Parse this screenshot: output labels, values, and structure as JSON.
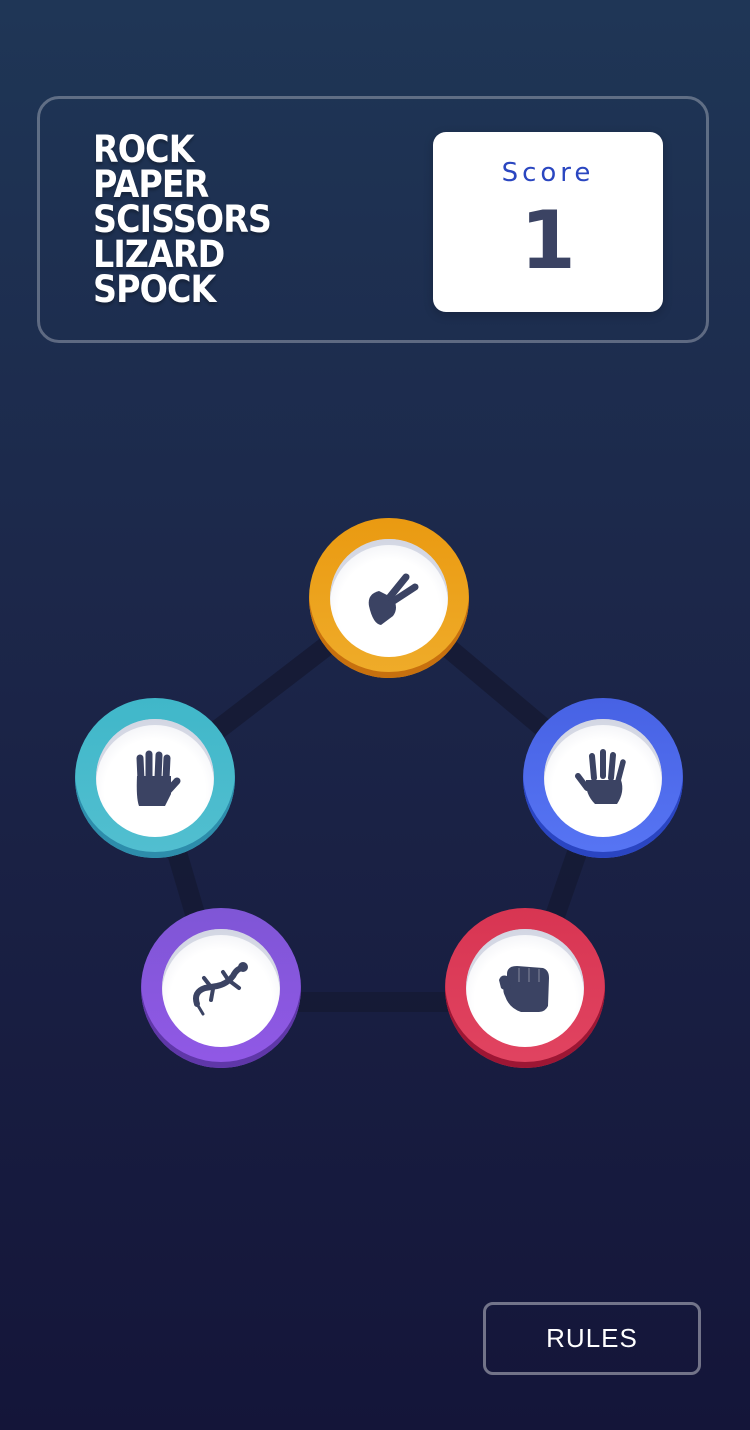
{
  "header": {
    "logo_lines": [
      "ROCK",
      "PAPER",
      "SCISSORS",
      "LIZARD",
      "SPOCK"
    ],
    "score_label": "Score",
    "score_value": "1"
  },
  "tokens": [
    {
      "id": "scissors",
      "icon": "scissors-hand-icon",
      "color": "#ec9e0e"
    },
    {
      "id": "paper",
      "icon": "paper-hand-icon",
      "color": "#4865f4"
    },
    {
      "id": "rock",
      "icon": "rock-fist-icon",
      "color": "#dc2e4e"
    },
    {
      "id": "lizard",
      "icon": "lizard-icon",
      "color": "#8856e0"
    },
    {
      "id": "spock",
      "icon": "spock-hand-icon",
      "color": "#40b9ce"
    }
  ],
  "colors": {
    "icon_fill": "#3b4363",
    "score_label": "#2a46c0",
    "background_top": "#1f3656",
    "background_bottom": "#141539"
  },
  "footer": {
    "rules_label": "RULES"
  }
}
